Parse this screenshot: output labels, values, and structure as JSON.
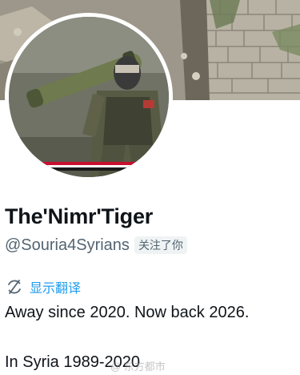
{
  "profile": {
    "display_name": "The'Nimr'Tiger",
    "handle": "@Souria4Syrians",
    "follows_you_badge": "关注了你",
    "translate_label": "显示翻译",
    "bio_lines": [
      "Away since 2020. Now back 2026.",
      "In Syria 1989-2020"
    ]
  },
  "watermark": "@ 东方都市",
  "icons": {
    "translate": "translate-icon"
  },
  "colors": {
    "link": "#1d9bf0",
    "secondary_text": "#536471",
    "badge_bg": "#eff3f4",
    "primary_text": "#0f1419"
  }
}
